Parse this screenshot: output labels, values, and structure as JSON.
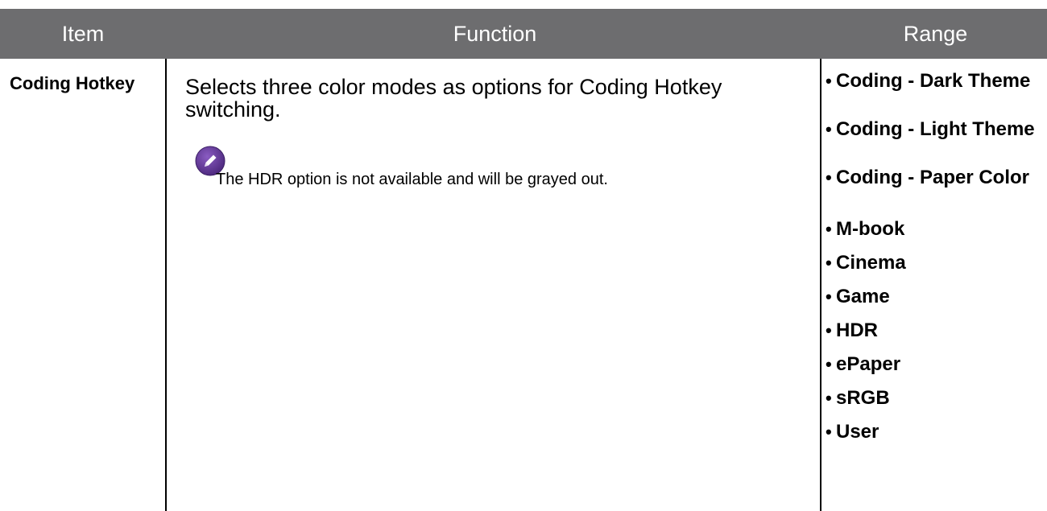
{
  "table": {
    "headers": {
      "item": "Item",
      "function": "Function",
      "range": "Range"
    },
    "row": {
      "item": "Coding Hotkey",
      "function": "Selects three color modes as options for Coding Hotkey switching.",
      "note": "The HDR option is not available and will be grayed out.",
      "note_icon": "pencil-note-icon",
      "range": [
        "Coding - Dark Theme",
        "Coding - Light Theme",
        "Coding - Paper Color",
        "M-book",
        "Cinema",
        "Game",
        "HDR",
        "ePaper",
        "sRGB",
        "User"
      ],
      "bullet": "•"
    }
  },
  "colors": {
    "header_bg": "#6d6d6f",
    "header_text": "#ffffff",
    "note_icon": "#6b3fa0"
  }
}
